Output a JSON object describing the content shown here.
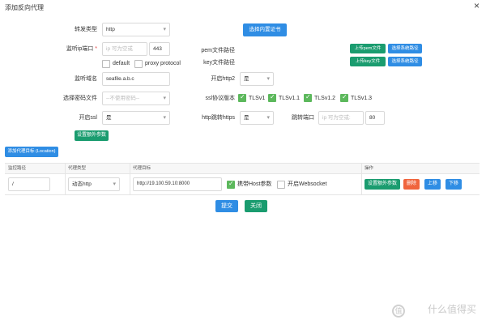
{
  "dialog": {
    "title": "添加反向代理",
    "close_glyph": "×"
  },
  "forward_type": {
    "label": "转发类型",
    "value": "http"
  },
  "builtin_cert_button": "选择内置证书",
  "listen": {
    "label": "监听ip端口",
    "ip_placeholder": "ip 可为空或",
    "port": "443",
    "default_label": "default",
    "proxy_protocol_label": "proxy protocol"
  },
  "domain": {
    "label": "监听域名",
    "value": "seafile.a.b.c"
  },
  "password_file": {
    "label": "选择密码文件",
    "placeholder": "--不使用密码--"
  },
  "ssl": {
    "label": "开启ssl",
    "value": "是"
  },
  "extra_params_button": "设置额外参数",
  "pem": {
    "label": "pem文件路径",
    "upload": "上传pem文件",
    "choose": "选择系统路径"
  },
  "key": {
    "label": "key文件路径",
    "upload": "上传key文件",
    "choose": "选择系统路径"
  },
  "http2": {
    "label": "开启http2",
    "value": "是"
  },
  "ssl_protocols": {
    "label": "ssl协议版本",
    "options": [
      {
        "label": "TLSv1",
        "checked": true
      },
      {
        "label": "TLSv1.1",
        "checked": true
      },
      {
        "label": "TLSv1.2",
        "checked": true
      },
      {
        "label": "TLSv1.3",
        "checked": true
      }
    ]
  },
  "http_redirect": {
    "label": "http跳转https",
    "value": "是"
  },
  "redirect_port": {
    "label": "跳转端口",
    "placeholder": "ip 可为空或:",
    "value": "80"
  },
  "add_location_button": "添加代理目标 (Location)",
  "table": {
    "headers": [
      "监控路径",
      "代理类型",
      "代理目标",
      "操作"
    ],
    "row": {
      "path": "/",
      "proxy_type": "动态http",
      "target": "http://19.100.59.10:8000",
      "carry_host_label": "携带Host参数",
      "carry_host_checked": true,
      "websocket_label": "开启Websocket",
      "websocket_checked": false,
      "actions": [
        "设置额外参数",
        "删除",
        "上移",
        "下移"
      ]
    }
  },
  "footer": {
    "submit": "提交",
    "close": "关闭"
  },
  "watermark": {
    "icon": "值",
    "text": "什么值得买"
  }
}
